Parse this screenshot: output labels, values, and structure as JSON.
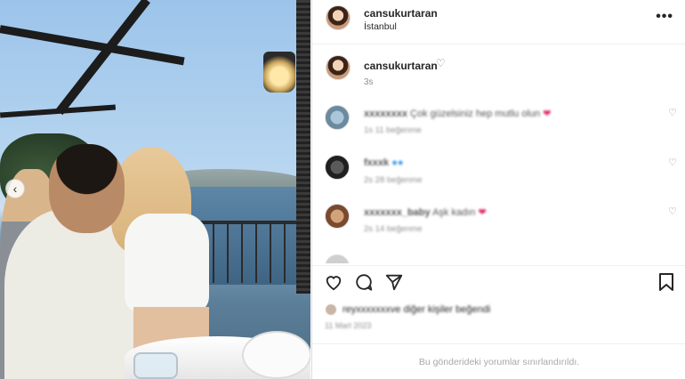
{
  "post": {
    "username": "cansukurtaran",
    "location": "İstanbul",
    "more_label": "•••",
    "carousel_prev": "‹"
  },
  "caption": {
    "username": "cansukurtaran",
    "heart": "♡",
    "time": "3s"
  },
  "comments": [
    {
      "user": "xxxxxxxx",
      "text": "Çok güzelsiniz hep mutlu olun",
      "emoji": "❤",
      "emoji_type": "heart",
      "meta": "1s   11 beğenme"
    },
    {
      "user": "fxxxk",
      "text": "",
      "emoji": "●●",
      "emoji_type": "verified",
      "meta": "2s   28 beğenme"
    },
    {
      "user": "xxxxxxx_baby",
      "text": "Aşk kadın",
      "emoji": "❤",
      "emoji_type": "heart",
      "meta": "2s   14 beğenme"
    }
  ],
  "comment_like_icon": "♡",
  "likes_text": "reyxxxxxxxve diğer kişiler beğendi",
  "date_text": "11 Mart 2023",
  "footer_text": "Bu gönderideki yorumlar sınırlandırıldı.",
  "colors": {
    "accent": "#3897f0",
    "heart": "#e0245e",
    "muted": "#8e8e8e"
  }
}
